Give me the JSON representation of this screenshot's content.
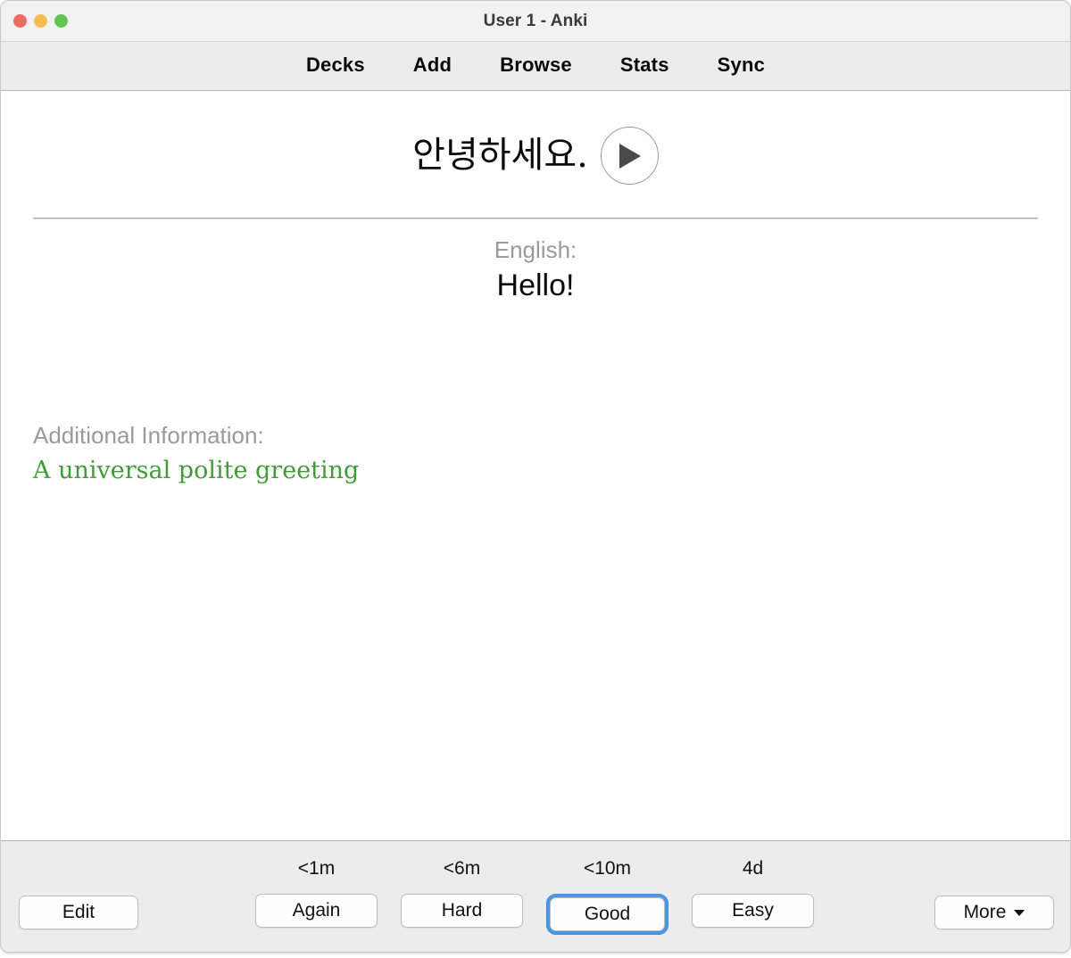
{
  "window": {
    "title": "User 1 - Anki",
    "traffic_lights": [
      {
        "name": "close",
        "color": "#ec6a5f"
      },
      {
        "name": "minimize",
        "color": "#f4bd4f"
      },
      {
        "name": "zoom",
        "color": "#61c554"
      }
    ]
  },
  "nav": {
    "items": [
      {
        "label": "Decks"
      },
      {
        "label": "Add"
      },
      {
        "label": "Browse"
      },
      {
        "label": "Stats"
      },
      {
        "label": "Sync"
      }
    ]
  },
  "card": {
    "question": "안녕하세요.",
    "play_icon": "play-icon",
    "answer_label": "English:",
    "answer_value": "Hello!",
    "extra_label": "Additional Information:",
    "extra_value": "A universal polite greeting",
    "extra_color": "#3f9c36"
  },
  "bottom_bar": {
    "edit_label": "Edit",
    "more_label": "More",
    "more_caret": "caret-down-icon",
    "focus_color": "#4c97e8",
    "ease_buttons": [
      {
        "interval": "<1m",
        "label": "Again",
        "focused": false
      },
      {
        "interval": "<6m",
        "label": "Hard",
        "focused": false
      },
      {
        "interval": "<10m",
        "label": "Good",
        "focused": true
      },
      {
        "interval": "4d",
        "label": "Easy",
        "focused": false
      }
    ]
  }
}
